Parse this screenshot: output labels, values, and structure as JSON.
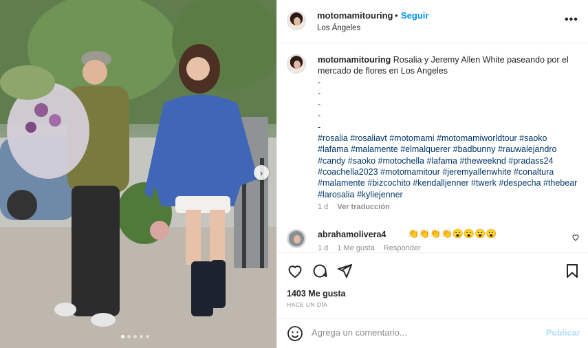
{
  "photo": {
    "alt_semantic": "street-photo",
    "carousel_total": 5,
    "carousel_active": 0
  },
  "header": {
    "username": "motomamitouring",
    "separator": "•",
    "follow_label": "Seguir",
    "location": "Los Ángeles",
    "more_label": "•••"
  },
  "caption": {
    "username": "motomamitouring",
    "text": "Rosalia y Jeremy Allen White paseando por el mercado de flores en Los Angeles",
    "dashes": [
      "-",
      "-",
      "-",
      "-",
      "-"
    ],
    "hashtags": "#rosalia #rosaliavt #motomami #motomamiworldtour #saoko #lafama #malamente #elmalquerer #badbunny #rauwalejandro #candy #saoko #motochella #lafama #theweeknd #pradass24 #coachella2023 #motomamitour #jeremyallenwhite #conaltura #malamente #bizcochito #kendalljenner #twerk #despecha #thebear #larosalia #kyliejenner",
    "time": "1 d",
    "translate_label": "Ver traducción"
  },
  "comment": {
    "username": "abrahamolivera4",
    "text": "👏👏👏👏😮😮😮😮",
    "time": "1 d",
    "likes": "1 Me gusta",
    "reply_label": "Responder"
  },
  "actions": {
    "likes": "1403 Me gusta",
    "ago": "HACE UN DÍA"
  },
  "composer": {
    "placeholder": "Agrega un comentario...",
    "post_label": "Publicar"
  },
  "colors": {
    "link": "#0095f6",
    "hashtag": "#00376b",
    "muted": "#8e8e8e",
    "post_disabled": "#b2dffc"
  }
}
